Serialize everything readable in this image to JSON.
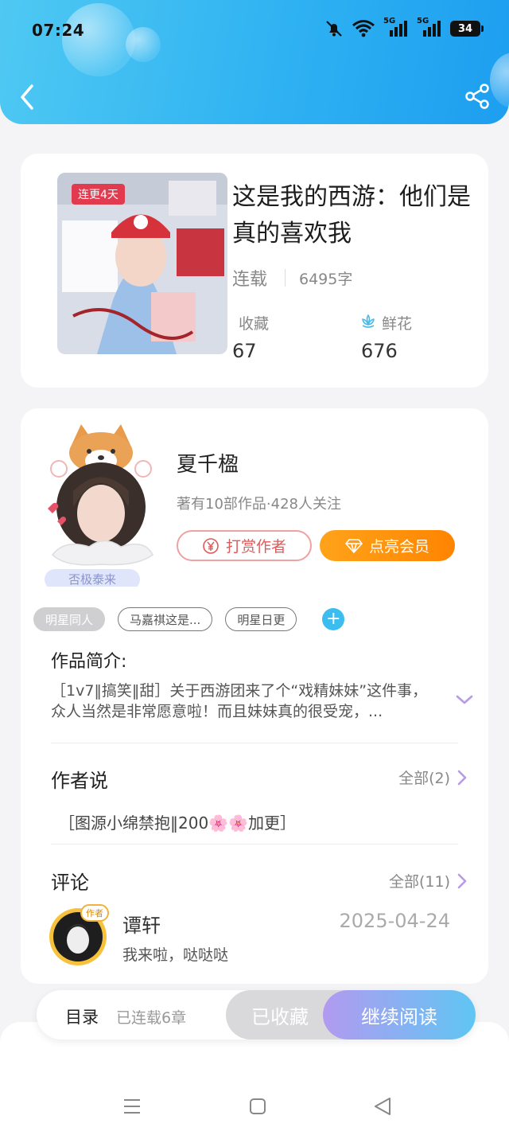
{
  "status_bar": {
    "time": "07:24",
    "network_1": "5G",
    "network_2": "5G",
    "battery": "34",
    "icons": [
      "mute-bell-icon",
      "wifi-icon",
      "signal-icon",
      "signal-icon",
      "battery-icon"
    ]
  },
  "header": {
    "back_icon": "chevron-left-icon",
    "share_icon": "share-icon"
  },
  "book": {
    "cover_badge": "连更4天",
    "title": "这是我的西游：他们是真的喜欢我",
    "status": "连载",
    "word_count": "6495字",
    "collect_label": "收藏",
    "collect_value": "67",
    "flower_label": "鲜花",
    "flower_value": "676"
  },
  "author": {
    "name": "夏千楹",
    "badge": "否极泰来",
    "info": "著有10部作品·428人关注",
    "tip_button": "打赏作者",
    "vip_button": "点亮会员"
  },
  "tags": [
    "明星同人",
    "马嘉祺这是...",
    "明星日更"
  ],
  "intro": {
    "title": "作品简介:",
    "text": "［1v7‖搞笑‖甜］关于西游团来了个“戏精妹妹”这件事，众人当然是非常愿意啦！而且妹妹真的很受宠，..."
  },
  "author_say": {
    "title": "作者说",
    "more": "全部(2)",
    "content": "［图源小绵禁抱‖200🌸🌸加更］"
  },
  "comments": {
    "title": "评论",
    "more": "全部(11)",
    "items": [
      {
        "avatar_badge": "作者",
        "name": "谭轩",
        "date": "2025-04-24",
        "text": "我来啦，哒哒哒"
      }
    ]
  },
  "bottom_bar": {
    "toc": "目录",
    "toc_sub": "已连载6章",
    "collected": "已收藏",
    "continue": "继续阅读"
  },
  "colors": {
    "header_blue": "#2fb2f2",
    "accent_orange": "#ff8400",
    "accent_red": "#e05a5a",
    "tag_blue": "#3bbdf0"
  }
}
